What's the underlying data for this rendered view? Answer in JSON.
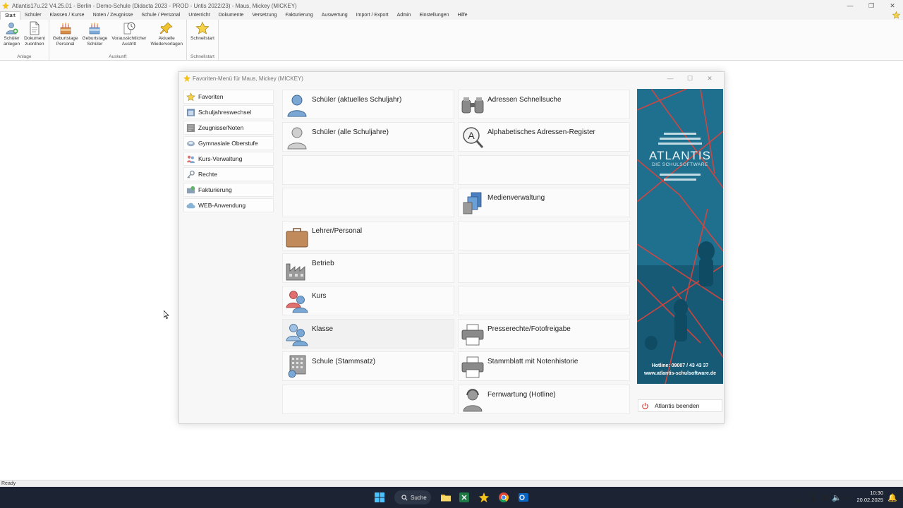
{
  "window": {
    "title": "Atlantis17u.22 V4.25.01 - Berlin - Demo-Schule (Didacta 2023 - PROD - Untis 2022/23) - Maus, Mickey (MICKEY)"
  },
  "menu": {
    "tabs": [
      "Start",
      "Schüler",
      "Klassen / Kurse",
      "Noten / Zeugnisse",
      "Schule / Personal",
      "Unterricht",
      "Dokumente",
      "Versetzung",
      "Fakturierung",
      "Auswertung",
      "Import / Export",
      "Admin",
      "Einstellungen",
      "Hilfe"
    ],
    "active": "Start"
  },
  "ribbon": {
    "groups": [
      {
        "label": "Anlage",
        "buttons": [
          "Schüler\nanlegen",
          "Dokument\nzuordnen"
        ]
      },
      {
        "label": "Auskunft",
        "buttons": [
          "Geburtstage\nPersonal",
          "Geburtstage\nSchüler",
          "Voraussichtlicher\nAustritt",
          "Aktuelle\nWiedervorlagen"
        ]
      },
      {
        "label": "Schnellstart",
        "buttons": [
          "Schnellstart"
        ]
      }
    ]
  },
  "dialog": {
    "title": "Favoriten-Menü für Maus, Mickey (MICKEY)",
    "sidebar": [
      "Favoriten",
      "Schuljahreswechsel",
      "Zeugnisse/Noten",
      "Gymnasiale Oberstufe",
      "Kurs-Verwaltung",
      "Rechte",
      "Fakturierung",
      "WEB-Anwendung"
    ],
    "tiles_left": [
      "Schüler (aktuelles Schuljahr)",
      "Schüler (alle Schuljahre)",
      "",
      "",
      "Lehrer/Personal",
      "Betrieb",
      "Kurs",
      "Klasse",
      "Schule (Stammsatz)",
      ""
    ],
    "tiles_right": [
      "Adressen Schnellsuche",
      "Alphabetisches Adressen-Register",
      "",
      "Medienverwaltung",
      "",
      "",
      "",
      "Presserechte/Fotofreigabe",
      "Stammblatt mit Notenhistorie",
      "Fernwartung (Hotline)"
    ],
    "banner": {
      "brand": "ATLANTIS",
      "tagline": "DIE SCHULSOFTWARE",
      "hotline": "Hotline: 09007 / 43 43 37",
      "website": "www.atlantis-schulsoftware.de"
    },
    "exit_label": "Atlantis beenden"
  },
  "status": {
    "text": "Ready"
  },
  "taskbar": {
    "search_label": "Suche",
    "time": "10:30",
    "date": "20.02.2025"
  },
  "colors": {
    "accent_blue": "#5b8fc7",
    "person_blue": "#7aa7d4",
    "person_red": "#e07070",
    "briefcase": "#c08a5a",
    "banner_bg": "#1f6f8f",
    "banner_line": "#e0433a",
    "taskbar_bg": "#1c2433"
  }
}
